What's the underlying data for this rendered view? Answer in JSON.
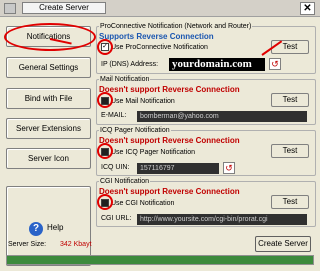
{
  "window": {
    "title": "Create Server",
    "close_glyph": "✕",
    "icons": [
      "app-icon",
      "close-icon"
    ]
  },
  "sidebar": {
    "buttons": [
      {
        "label": "Notifications"
      },
      {
        "label": "General Settings"
      },
      {
        "label": "Bind with File"
      },
      {
        "label": "Server Extensions"
      },
      {
        "label": "Server Icon"
      }
    ],
    "help_label": "Help",
    "help_icon": "?"
  },
  "proconnective": {
    "group_title": "ProConnective Notification (Network and Router)",
    "support_text": "Supports Reverse Connection",
    "checkbox_label": "Use ProConnective Notification",
    "checkbox_checked": true,
    "test_label": "Test",
    "ip_label": "IP (DNS) Address:",
    "ip_value": "yourdomain.com"
  },
  "mail": {
    "group_title": "Mail Notification",
    "support_text": "Doesn't support Reverse Connection",
    "checkbox_label": "Use Mail Notification",
    "test_label": "Test",
    "email_label": "E-MAIL:",
    "email_value": "bomberman@yahoo.com"
  },
  "icq": {
    "group_title": "ICQ Pager Notification",
    "support_text": "Doesn't support Reverse Connection",
    "checkbox_label": "Use ICQ Pager Notification",
    "test_label": "Test",
    "uin_label": "ICQ UIN:",
    "uin_value": "157116797"
  },
  "cgi": {
    "group_title": "CGI Notification",
    "support_text": "Doesn't support Reverse Connection",
    "checkbox_label": "Use CGI Notification",
    "test_label": "Test",
    "url_label": "CGI URL:",
    "url_value": "http://www.yoursite.com/cgi-bin/prorat.cgi"
  },
  "footer": {
    "server_size_label": "Server Size:",
    "server_size_value": "342 Kbayt",
    "create_label": "Create Server",
    "progress_percent": 100
  },
  "colors": {
    "accent_blue": "#1a56b0",
    "warning_red": "#c00000",
    "annotation_red": "#e00000",
    "progress_green": "#3c8a3c"
  }
}
